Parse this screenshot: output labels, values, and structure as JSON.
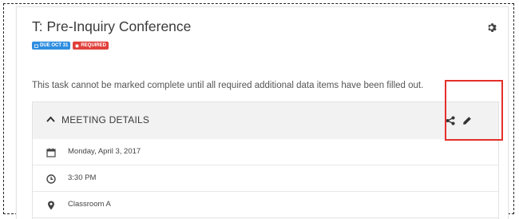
{
  "task": {
    "title": "T: Pre-Inquiry Conference",
    "badges": {
      "due": "DUE OCT 31",
      "required": "REQUIRED"
    },
    "notice": "This task cannot be marked complete until all required additional data items have been filled out."
  },
  "meeting_details": {
    "header_label": "MEETING DETAILS",
    "rows": [
      {
        "icon": "calendar-icon",
        "text": "Monday, April 3, 2017"
      },
      {
        "icon": "clock-icon",
        "text": "3:30 PM"
      },
      {
        "icon": "map-marker-icon",
        "text": "Classroom A"
      }
    ]
  },
  "colors": {
    "due_badge": "#2f8ee0",
    "required_badge": "#e0403c",
    "highlight": "#e4302b"
  }
}
